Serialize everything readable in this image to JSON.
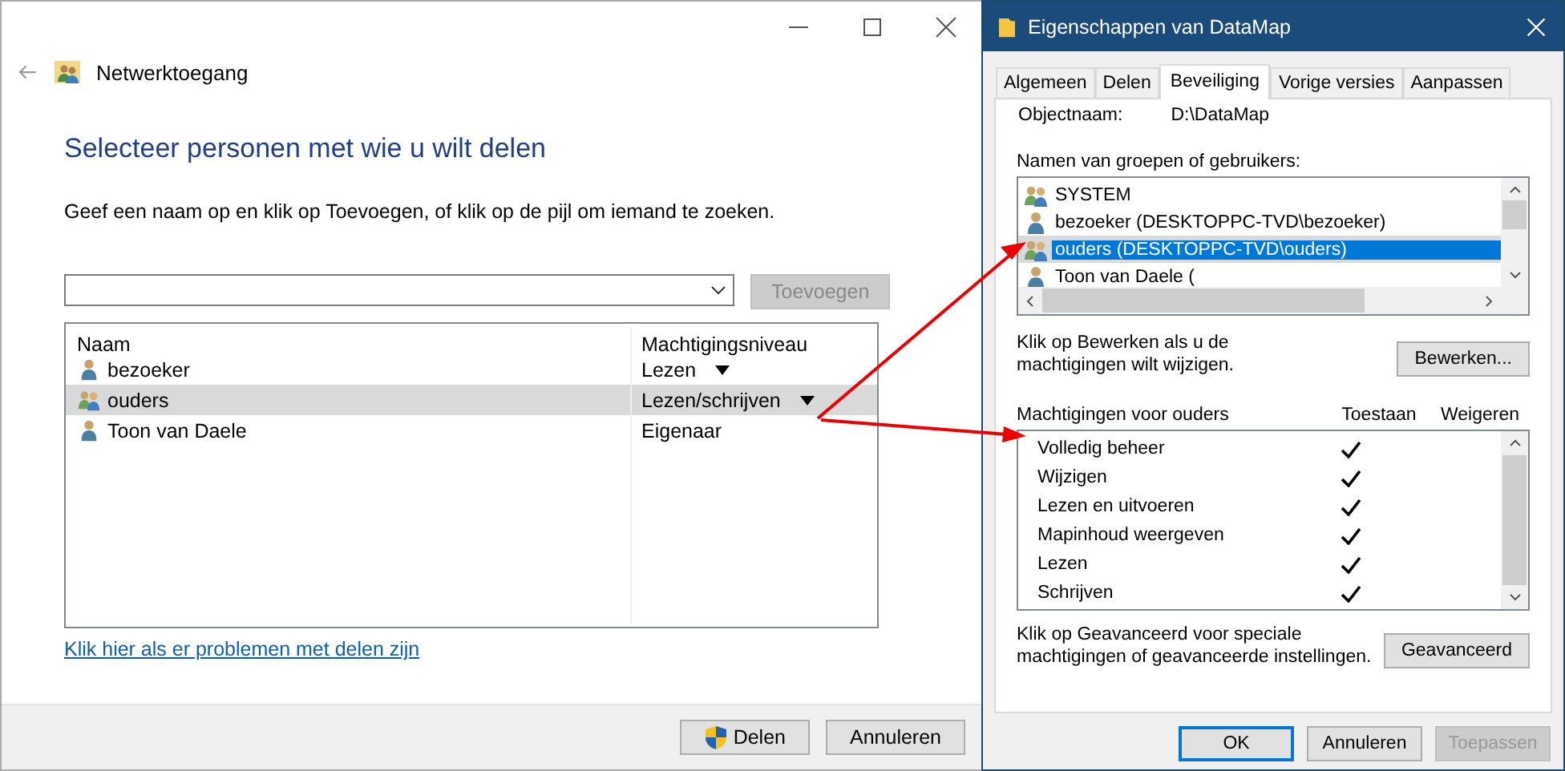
{
  "share_window": {
    "title": "Netwerktoegang",
    "heading": "Selecteer personen met wie u wilt delen",
    "instruction": "Geef een naam op en klik op Toevoegen, of klik op de pijl om iemand te zoeken.",
    "add_button": {
      "label": "Toevoegen",
      "disabled": true
    },
    "table": {
      "columns": [
        "Naam",
        "Machtigingsniveau"
      ],
      "rows": [
        {
          "name": "bezoeker",
          "kind": "user",
          "level": "Lezen",
          "dropdown": true,
          "selected": false
        },
        {
          "name": "ouders",
          "kind": "group",
          "level": "Lezen/schrijven",
          "dropdown": true,
          "selected": true
        },
        {
          "name": "Toon van Daele",
          "kind": "user",
          "level": "Eigenaar",
          "dropdown": false,
          "selected": false
        }
      ]
    },
    "help_link": "Klik hier als er problemen met delen zijn",
    "buttons": [
      {
        "label": "Delen",
        "kind": "shield"
      },
      {
        "label": "Annuleren",
        "kind": "plain"
      }
    ]
  },
  "properties_window": {
    "title": "Eigenschappen van DataMap",
    "tabs": [
      {
        "label": "Algemeen",
        "selected": false
      },
      {
        "label": "Delen",
        "selected": false
      },
      {
        "label": "Beveiliging",
        "selected": true
      },
      {
        "label": "Vorige versies",
        "selected": false
      },
      {
        "label": "Aanpassen",
        "selected": false
      }
    ],
    "object_label": "Objectnaam:",
    "object_value": "D:\\DataMap",
    "users_label": "Namen van groepen of gebruikers:",
    "users": [
      {
        "name": "SYSTEM",
        "kind": "group",
        "selected": false
      },
      {
        "name": "bezoeker (DESKTOPPC-TVD\\bezoeker)",
        "kind": "user",
        "selected": false
      },
      {
        "name": "ouders (DESKTOPPC-TVD\\ouders)",
        "kind": "group",
        "selected": true
      },
      {
        "name": "Toon van Daele (",
        "kind": "user",
        "selected": false
      }
    ],
    "edit_note": "Klik op Bewerken als u de machtigingen wilt wijzigen.",
    "edit_button": "Bewerken...",
    "permissions": {
      "title": "Machtigingen voor ouders",
      "columns": [
        "Toestaan",
        "Weigeren"
      ],
      "rows": [
        {
          "name": "Volledig beheer",
          "allow": true,
          "deny": false
        },
        {
          "name": "Wijzigen",
          "allow": true,
          "deny": false
        },
        {
          "name": "Lezen en uitvoeren",
          "allow": true,
          "deny": false
        },
        {
          "name": "Mapinhoud weergeven",
          "allow": true,
          "deny": false
        },
        {
          "name": "Lezen",
          "allow": true,
          "deny": false
        },
        {
          "name": "Schrijven",
          "allow": true,
          "deny": false
        }
      ]
    },
    "advanced_note": "Klik op Geavanceerd voor speciale machtigingen of geavanceerde instellingen.",
    "advanced_button": "Geavanceerd",
    "buttons": [
      {
        "label": "OK",
        "kind": "default"
      },
      {
        "label": "Annuleren",
        "kind": "normal"
      },
      {
        "label": "Toepassen",
        "kind": "disabled"
      }
    ]
  }
}
